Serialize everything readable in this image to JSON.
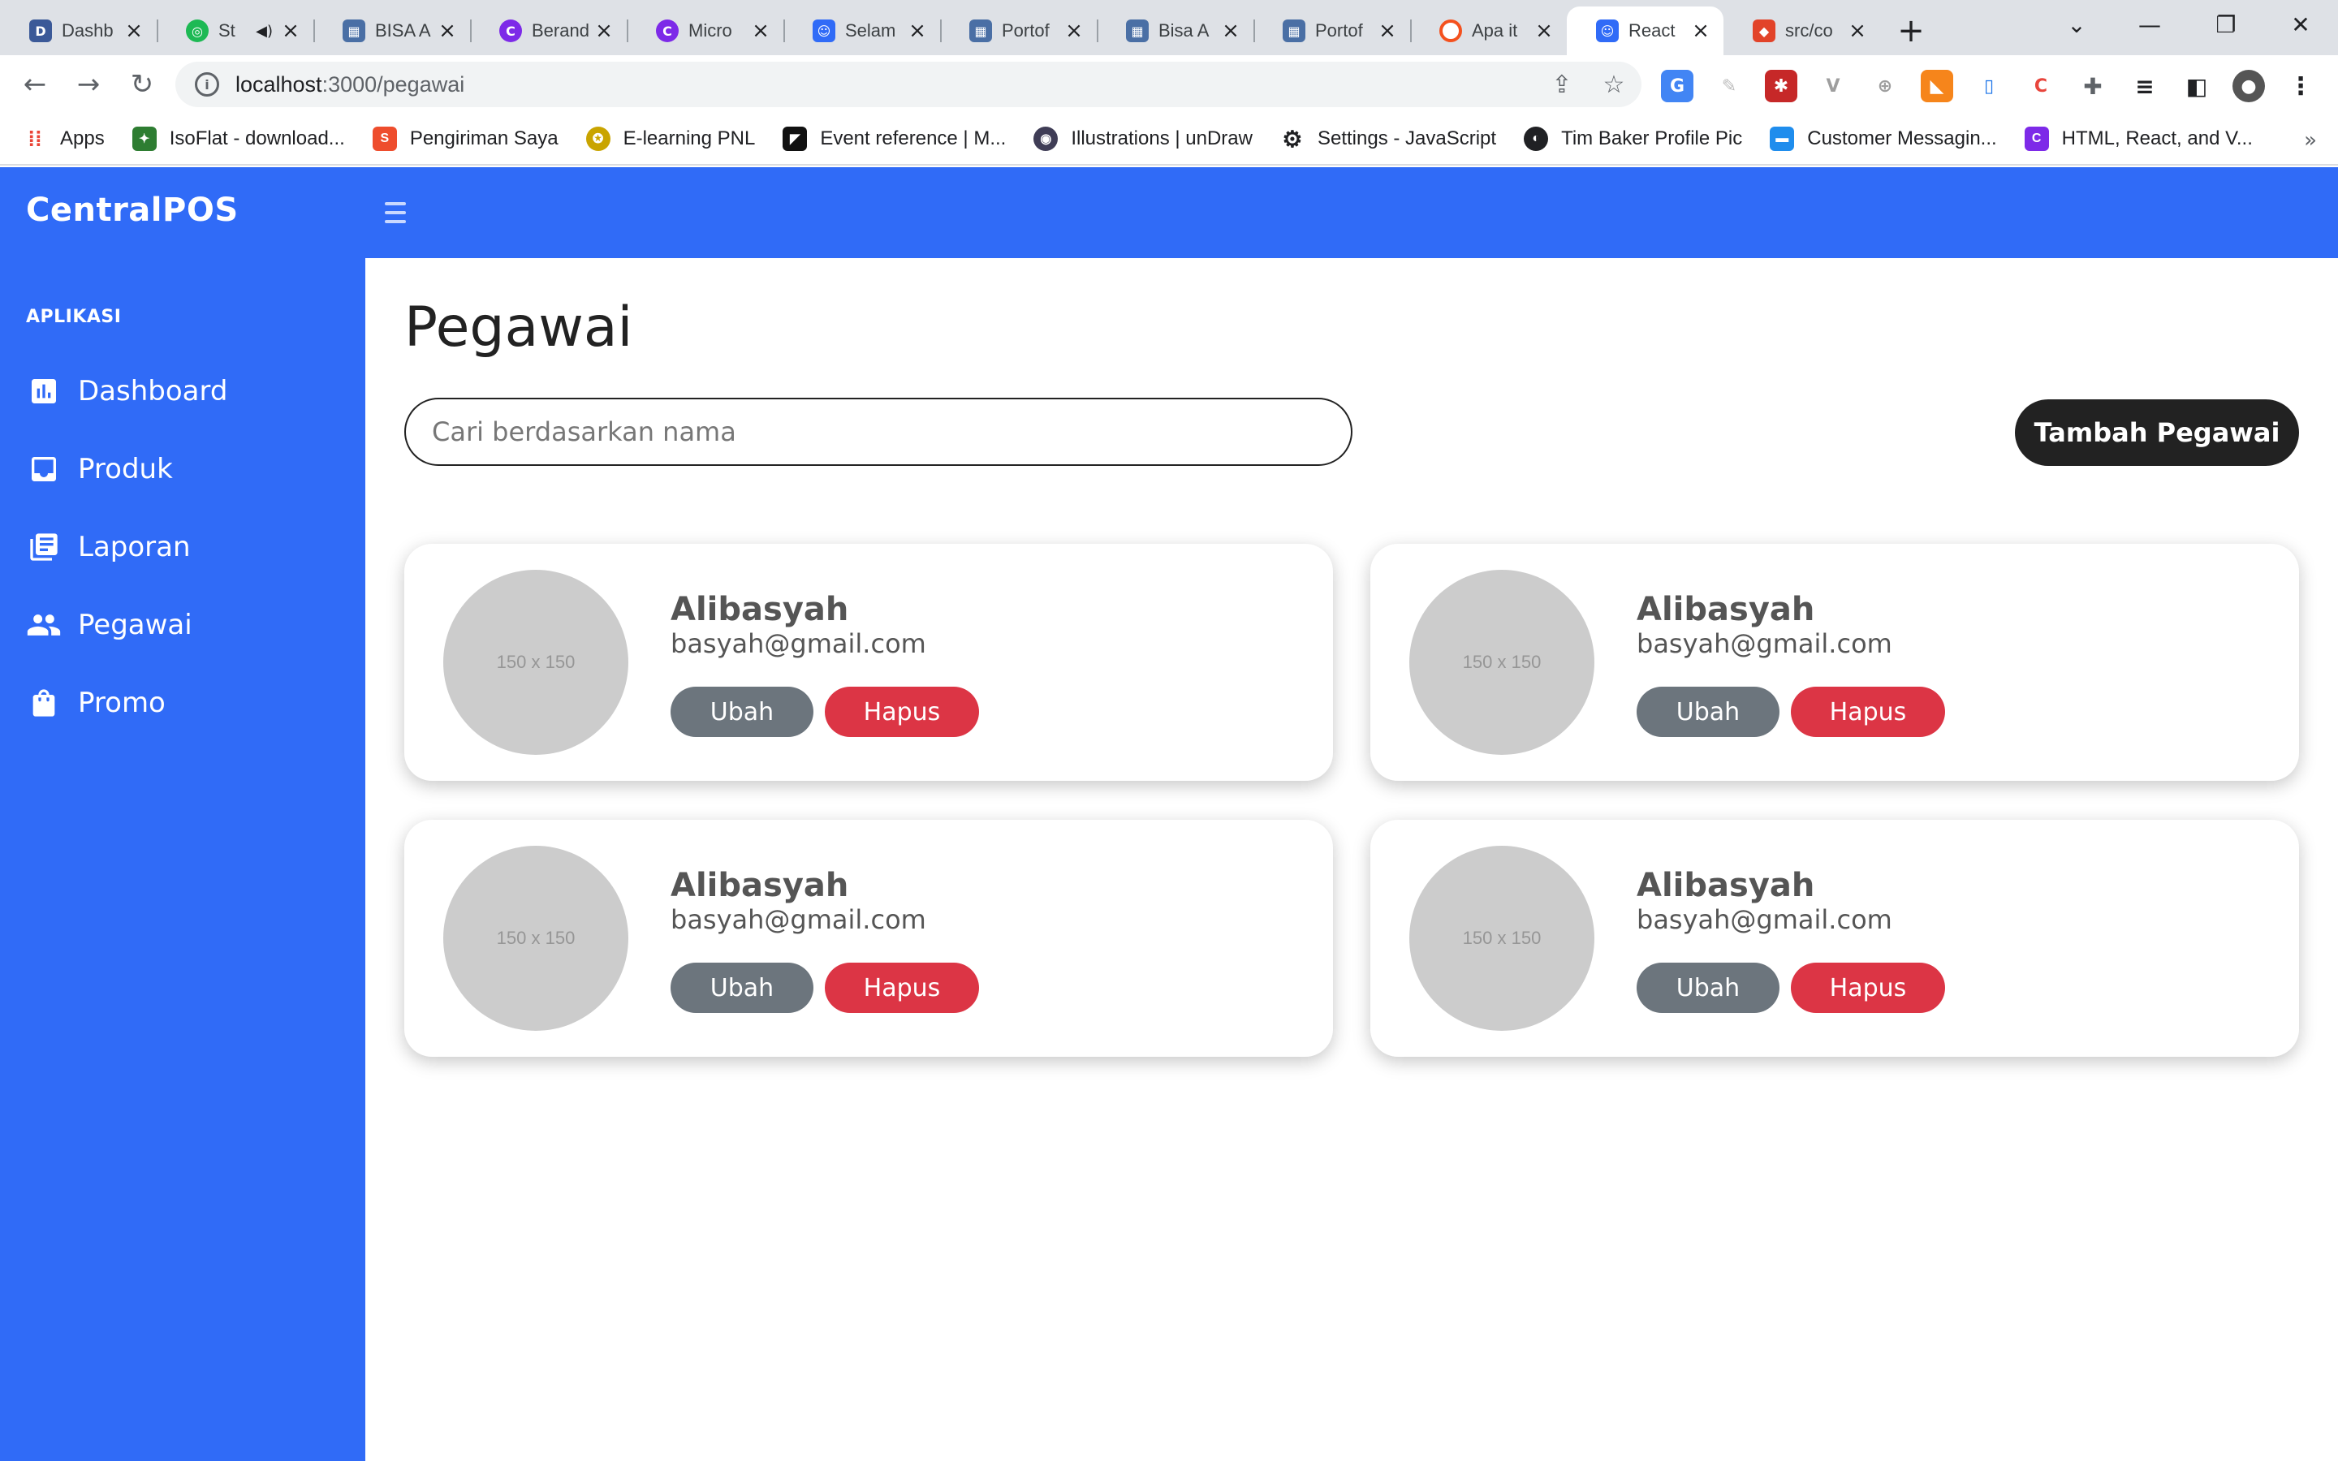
{
  "browser": {
    "tabs": [
      {
        "title": "Dashb",
        "icon": "dashboard-favicon",
        "color": "#3b5998"
      },
      {
        "title": "St",
        "icon": "spotify-favicon",
        "color": "#1db954",
        "muted": true
      },
      {
        "title": "BISA A",
        "icon": "bisa-favicon",
        "color": "#4a6fa5"
      },
      {
        "title": "Berand",
        "icon": "canva-favicon",
        "color": "#7d2ae8"
      },
      {
        "title": "Micro",
        "icon": "canva-favicon",
        "color": "#7d2ae8"
      },
      {
        "title": "Selam",
        "icon": "react-favicon",
        "color": "#306bf7"
      },
      {
        "title": "Portof",
        "icon": "bisa-favicon",
        "color": "#4a6fa5"
      },
      {
        "title": "Bisa A",
        "icon": "bisa-favicon",
        "color": "#4a6fa5"
      },
      {
        "title": "Portof",
        "icon": "bisa-favicon",
        "color": "#4a6fa5"
      },
      {
        "title": "Apa it",
        "icon": "ring-favicon",
        "color": "#f4511e"
      },
      {
        "title": "React",
        "icon": "react-favicon",
        "color": "#306bf7",
        "active": true
      },
      {
        "title": "src/co",
        "icon": "gitlab-favicon",
        "color": "#e24329"
      }
    ],
    "url_host": "localhost",
    "url_path": ":3000/pegawai",
    "bookmarks": [
      {
        "label": "Apps",
        "icon": "apps-grid-icon",
        "color": "#ea4335"
      },
      {
        "label": "IsoFlat - download...",
        "icon": "isoflat-icon",
        "color": "#2e7d32"
      },
      {
        "label": "Pengiriman Saya",
        "icon": "shopee-icon",
        "color": "#ee4d2d"
      },
      {
        "label": "E-learning PNL",
        "icon": "pnl-icon",
        "color": "#c9a400"
      },
      {
        "label": "Event reference | M...",
        "icon": "mdn-icon",
        "color": "#111111"
      },
      {
        "label": "Illustrations | unDraw",
        "icon": "undraw-icon",
        "color": "#3f3d56"
      },
      {
        "label": "Settings - JavaScript",
        "icon": "gear-icon",
        "color": "#202124"
      },
      {
        "label": "Tim Baker Profile Pic",
        "icon": "globe-icon",
        "color": "#202124"
      },
      {
        "label": "Customer Messagin...",
        "icon": "intercom-icon",
        "color": "#1f8ded"
      },
      {
        "label": "HTML, React, and V...",
        "icon": "canva-favicon",
        "color": "#7d2ae8"
      }
    ]
  },
  "app": {
    "brand": "CentralPOS",
    "section_label": "APLIKASI",
    "nav": [
      {
        "label": "Dashboard",
        "icon": "bar-chart-icon"
      },
      {
        "label": "Produk",
        "icon": "inbox-icon"
      },
      {
        "label": "Laporan",
        "icon": "library-books-icon"
      },
      {
        "label": "Pegawai",
        "icon": "people-icon"
      },
      {
        "label": "Promo",
        "icon": "shopping-bag-icon"
      }
    ],
    "colors": {
      "primary": "#306bf7",
      "dark": "#222222",
      "edit": "#6c757d",
      "delete": "#dc3545"
    }
  },
  "page": {
    "title": "Pegawai",
    "search_placeholder": "Cari berdasarkan nama",
    "add_label": "Tambah Pegawai"
  },
  "employees": [
    {
      "name": "Alibasyah",
      "email": "basyah@gmail.com",
      "avatar_text": "150 x 150",
      "edit_label": "Ubah",
      "delete_label": "Hapus"
    },
    {
      "name": "Alibasyah",
      "email": "basyah@gmail.com",
      "avatar_text": "150 x 150",
      "edit_label": "Ubah",
      "delete_label": "Hapus"
    },
    {
      "name": "Alibasyah",
      "email": "basyah@gmail.com",
      "avatar_text": "150 x 150",
      "edit_label": "Ubah",
      "delete_label": "Hapus"
    },
    {
      "name": "Alibasyah",
      "email": "basyah@gmail.com",
      "avatar_text": "150 x 150",
      "edit_label": "Ubah",
      "delete_label": "Hapus"
    }
  ]
}
